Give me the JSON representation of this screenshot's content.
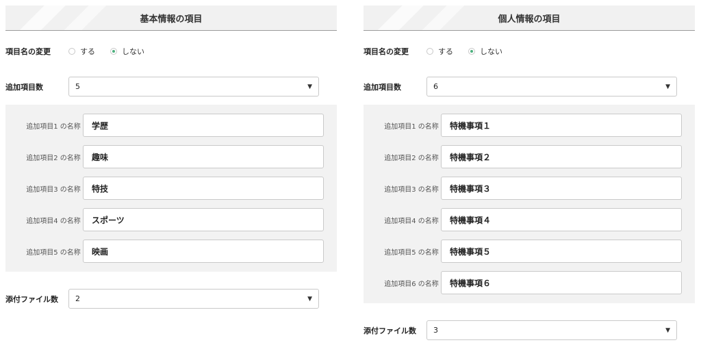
{
  "left": {
    "title": "基本情報の項目",
    "rename_label": "項目名の変更",
    "rename_options": [
      "する",
      "しない"
    ],
    "rename_selected": "しない",
    "count_label": "追加項目数",
    "count_value": "5",
    "items": [
      {
        "label": "追加項目1 の名称",
        "value": "学歴"
      },
      {
        "label": "追加項目2 の名称",
        "value": "趣味"
      },
      {
        "label": "追加項目3 の名称",
        "value": "特技"
      },
      {
        "label": "追加項目4 の名称",
        "value": "スポーツ"
      },
      {
        "label": "追加項目5 の名称",
        "value": "映画"
      }
    ],
    "files_label": "添付ファイル数",
    "files_value": "2"
  },
  "right": {
    "title": "個人情報の項目",
    "rename_label": "項目名の変更",
    "rename_options": [
      "する",
      "しない"
    ],
    "rename_selected": "しない",
    "count_label": "追加項目数",
    "count_value": "6",
    "items": [
      {
        "label": "追加項目1 の名称",
        "value": "特機事項１"
      },
      {
        "label": "追加項目2 の名称",
        "value": "特機事項２"
      },
      {
        "label": "追加項目3 の名称",
        "value": "特機事項３"
      },
      {
        "label": "追加項目4 の名称",
        "value": "特機事項４"
      },
      {
        "label": "追加項目5 の名称",
        "value": "特機事項５"
      },
      {
        "label": "追加項目6 の名称",
        "value": "特機事項６"
      }
    ],
    "files_label": "添付ファイル数",
    "files_value": "3"
  },
  "icons": {
    "dropdown": "chevron-down-icon",
    "radio": "radio-icon"
  },
  "colors": {
    "radio_selected": "#4caf7d",
    "panel_bg": "#f2f2f2",
    "border": "#c9c9c9"
  }
}
